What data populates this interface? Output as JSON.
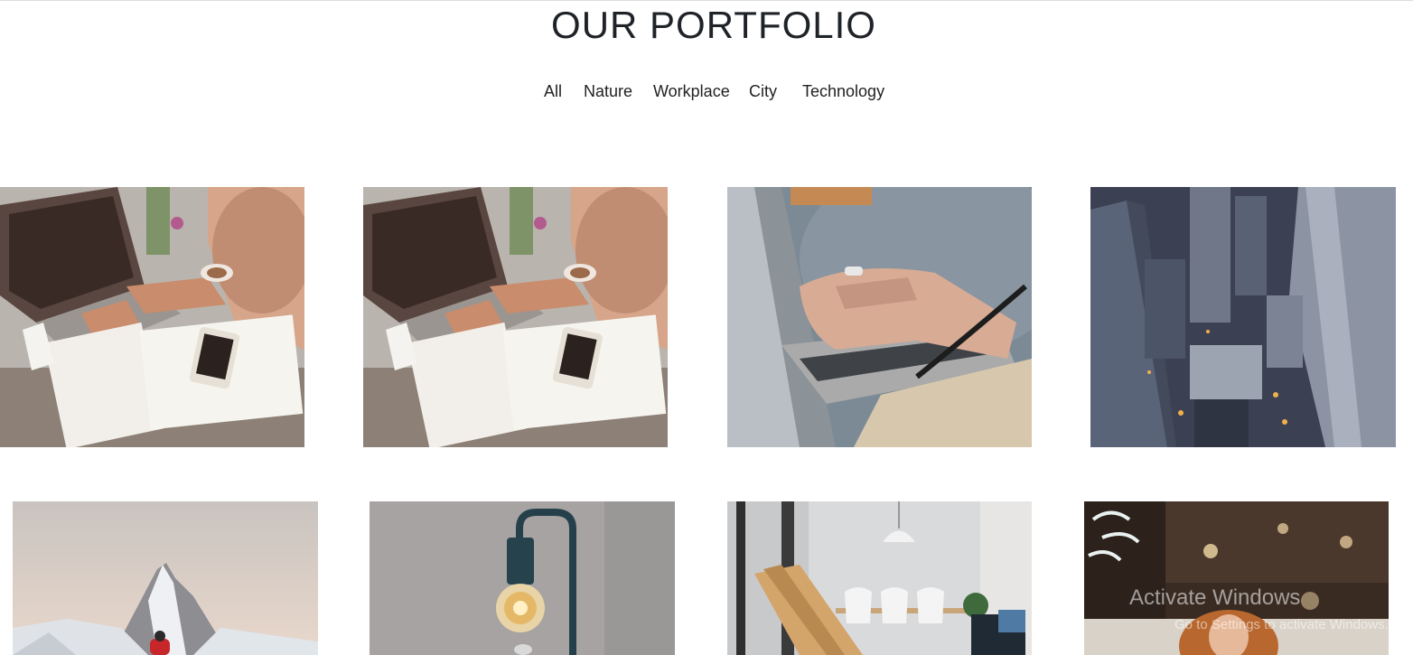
{
  "header": {
    "title": "OUR PORTFOLIO"
  },
  "filters": [
    {
      "label": "All"
    },
    {
      "label": "Nature"
    },
    {
      "label": "Workplace"
    },
    {
      "label": "City"
    },
    {
      "label": "Technology"
    }
  ],
  "portfolio": {
    "items": [
      {
        "subject": "laptop-workspace-photo"
      },
      {
        "subject": "laptop-workspace-photo"
      },
      {
        "subject": "hands-typing-laptop-photo"
      },
      {
        "subject": "city-skyscrapers-aerial-photo"
      },
      {
        "subject": "snowy-mountain-peak-photo"
      },
      {
        "subject": "edison-bulb-lamp-photo"
      },
      {
        "subject": "white-dining-room-photo"
      },
      {
        "subject": "woman-in-cafe-photo"
      }
    ]
  },
  "os_watermark": {
    "title": "Activate Windows",
    "subtitle": "Go to Settings to activate Windows."
  }
}
